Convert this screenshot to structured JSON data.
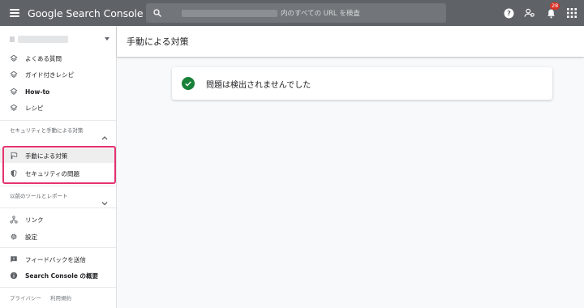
{
  "topbar": {
    "brand": "Google Search Console",
    "search_placeholder": "内のすべての URL を検査",
    "notification_count": "28"
  },
  "sidebar": {
    "items_top": [
      {
        "label": "よくある質問",
        "icon": "layers-icon"
      },
      {
        "label": "ガイド付きレシピ",
        "icon": "layers-icon"
      },
      {
        "label": "How-to",
        "icon": "layers-icon"
      },
      {
        "label": "レシピ",
        "icon": "layers-icon"
      }
    ],
    "security_section": {
      "title": "セキュリティと手動による対策",
      "items": [
        {
          "label": "手動による対策",
          "icon": "flag-icon"
        },
        {
          "label": "セキュリティの問題",
          "icon": "shield-icon"
        }
      ]
    },
    "legacy_section": {
      "title": "以前のツールとレポート"
    },
    "items_bottom": [
      {
        "label": "リンク",
        "icon": "links-icon"
      },
      {
        "label": "設定",
        "icon": "gear-icon"
      },
      {
        "label": "フィードバックを送信",
        "icon": "feedback-icon"
      },
      {
        "label": "Search Console の概要",
        "icon": "info-icon"
      }
    ],
    "footer": {
      "privacy": "プライバシー",
      "terms": "利用規約"
    }
  },
  "main": {
    "title": "手動による対策",
    "status_message": "問題は検出されませんでした"
  },
  "colors": {
    "topbar": "#5f6368",
    "success": "#188038",
    "highlight": "#e5326f"
  }
}
